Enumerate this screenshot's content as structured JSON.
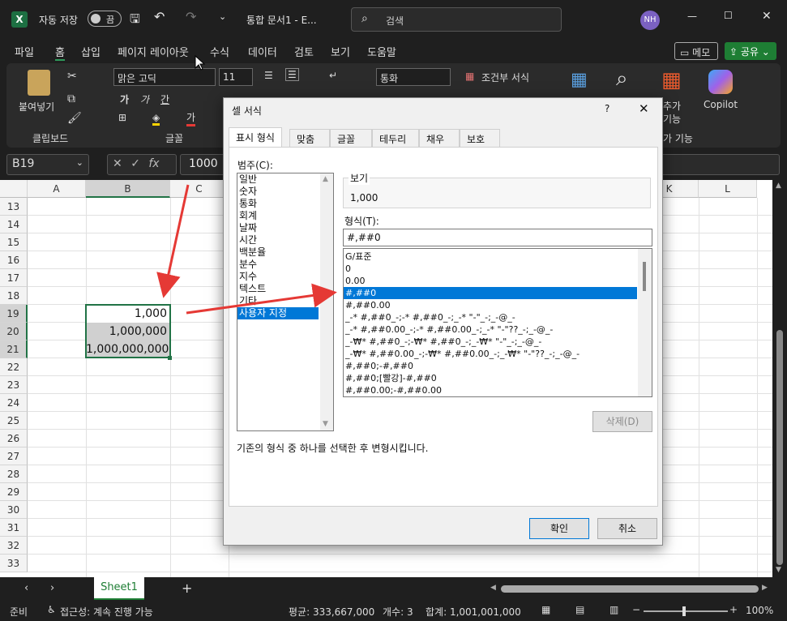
{
  "titlebar": {
    "autosave_label": "자동 저장",
    "autosave_toggle": "끔",
    "doc_title": "통합 문서1 - E...",
    "search_placeholder": "검색",
    "user_initials": "NH"
  },
  "menu": {
    "items": [
      "파일",
      "홈",
      "삽입",
      "페이지 레이아웃",
      "수식",
      "데이터",
      "검토",
      "보기",
      "도움말"
    ],
    "memo": "메모",
    "share": "공유"
  },
  "ribbon": {
    "paste": "붙여넣기",
    "clipboard": "클립보드",
    "font_name": "맑은 고딕",
    "font_size": "11",
    "font_group": "글꼴",
    "number_format": "통화",
    "conditional": "조건부 서식",
    "addins_1": "추가",
    "addins_2": "기능",
    "addins_group": "가 기능",
    "copilot": "Copilot"
  },
  "formula": {
    "namebox": "B19",
    "value": "1000"
  },
  "grid": {
    "columns": [
      "A",
      "B",
      "C",
      "",
      "",
      "",
      "",
      "",
      "",
      "",
      "K",
      "L"
    ],
    "rows": [
      "13",
      "14",
      "15",
      "16",
      "17",
      "18",
      "19",
      "20",
      "21",
      "22",
      "23",
      "24",
      "25",
      "26",
      "27",
      "28",
      "29",
      "30",
      "31",
      "32",
      "33"
    ],
    "cells": {
      "B19": "1,000",
      "B20": "1,000,000",
      "B21": "1,000,000,000"
    }
  },
  "sheet": {
    "tab": "Sheet1"
  },
  "status": {
    "ready": "준비",
    "accessibility": "접근성: 계속 진행 가능",
    "average": "평균: 333,667,000",
    "count": "개수: 3",
    "sum": "합계: 1,001,001,000",
    "zoom": "100%"
  },
  "dialog": {
    "title": "셀 서식",
    "help": "?",
    "tabs": [
      "표시 형식",
      "맞춤",
      "글꼴",
      "테두리",
      "채우기",
      "보호"
    ],
    "category_label": "범주(C):",
    "categories": [
      "일반",
      "숫자",
      "통화",
      "회계",
      "날짜",
      "시간",
      "백분율",
      "분수",
      "지수",
      "텍스트",
      "기타",
      "사용자 지정"
    ],
    "selected_category": "사용자 지정",
    "preview_label": "보기",
    "preview_value": "1,000",
    "type_label": "형식(T):",
    "type_value": "#,##0",
    "formats": [
      "G/표준",
      "0",
      "0.00",
      "#,##0",
      "#,##0.00",
      "_-* #,##0_-;-* #,##0_-;_-* \"-\"_-;_-@_-",
      "_-* #,##0.00_-;-* #,##0.00_-;_-* \"-\"??_-;_-@_-",
      "_-₩* #,##0_-;-₩* #,##0_-;_-₩* \"-\"_-;_-@_-",
      "_-₩* #,##0.00_-;-₩* #,##0.00_-;_-₩* \"-\"??_-;_-@_-",
      "#,##0;-#,##0",
      "#,##0;[빨강]-#,##0",
      "#,##0.00;-#,##0.00"
    ],
    "selected_format": "#,##0",
    "delete": "삭제(D)",
    "description": "기존의 형식 중 하나를 선택한 후 변형시킵니다.",
    "ok": "확인",
    "cancel": "취소"
  },
  "colors": {
    "accent": "#0078d7",
    "share_green": "#1e7e34",
    "annotation_red": "#e53935"
  }
}
